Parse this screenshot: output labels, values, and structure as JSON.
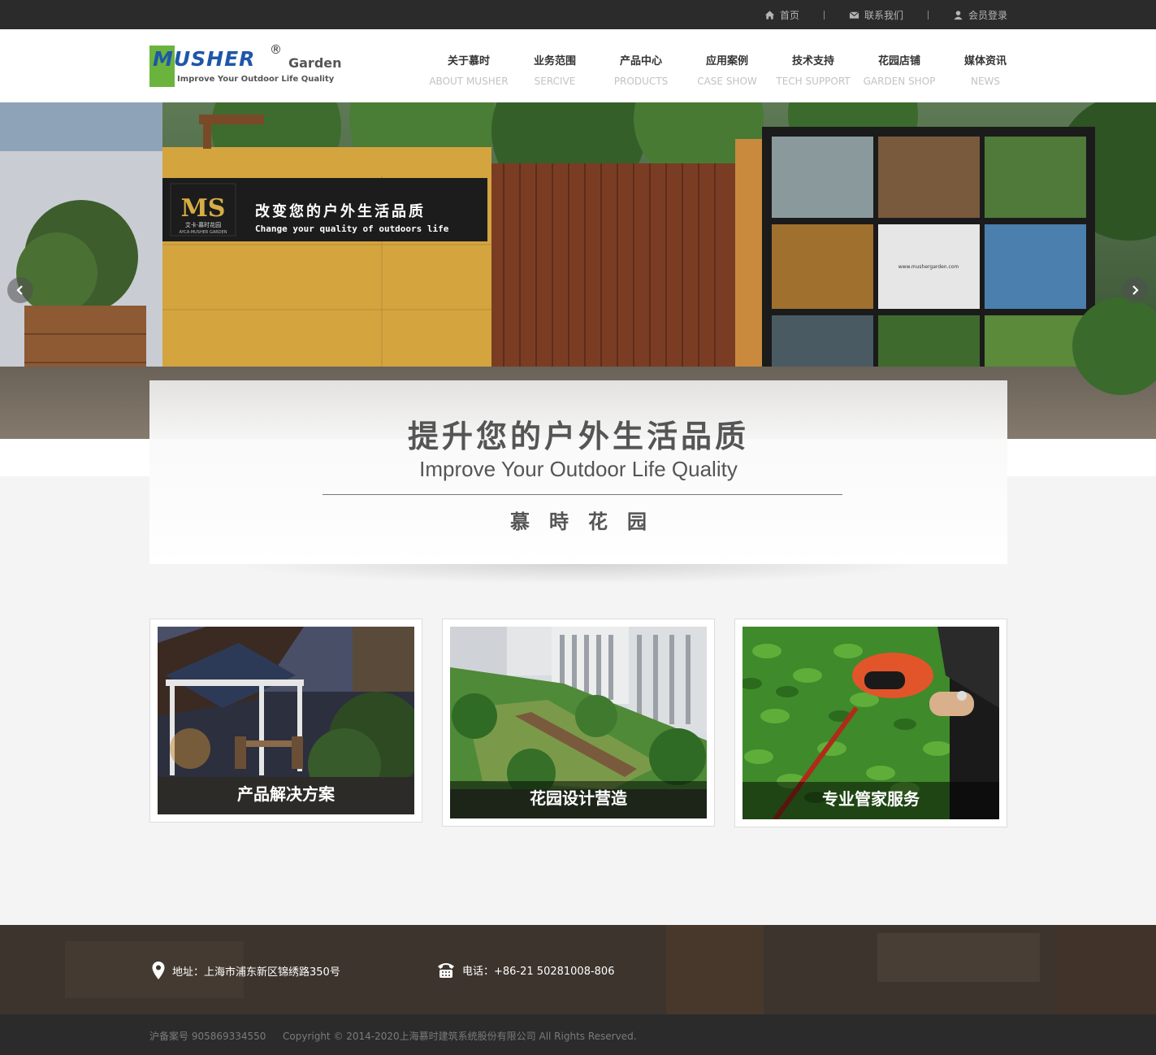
{
  "topbar": {
    "home": "首页",
    "contact": "联系我们",
    "login": "会员登录"
  },
  "logo": {
    "brand": "MUSHER",
    "reg": "®",
    "garden": "Garden",
    "tagline": "Improve Your Outdoor Life Quality"
  },
  "nav": [
    {
      "cn": "关于慕时",
      "en": "ABOUT MUSHER"
    },
    {
      "cn": "业务范围",
      "en": "SERCIVE"
    },
    {
      "cn": "产品中心",
      "en": "PRODUCTS"
    },
    {
      "cn": "应用案例",
      "en": "CASE SHOW"
    },
    {
      "cn": "技术支持",
      "en": "TECH SUPPORT"
    },
    {
      "cn": "花园店铺",
      "en": "GARDEN SHOP"
    },
    {
      "cn": "媒体资讯",
      "en": "NEWS"
    }
  ],
  "banner": {
    "sign_title": "改变您的户外生活品质",
    "sign_sub": "Change your quality of outdoors life",
    "sign_logo": "MS",
    "sign_logo_sub": "艾卡·慕时花园",
    "sign_logo_en": "AYCA·MUSHER GARDEN",
    "board_url": "www.mushergarden.com"
  },
  "overlay": {
    "title": "提升您的户外生活品质",
    "subtitle": "Improve Your Outdoor Life Quality",
    "brand": "慕時花园"
  },
  "cards": [
    {
      "caption": "产品解决方案"
    },
    {
      "caption": "花园设计营造"
    },
    {
      "caption": "专业管家服务"
    }
  ],
  "footer": {
    "address": "地址：上海市浦东新区锦绣路350号",
    "phone": "电话：+86-21 50281008-806",
    "icp": "沪备案号 905869334550",
    "copyright": "Copyright © 2014-2020上海慕时建筑系统股份有限公司 All Rights Reserved."
  },
  "colors": {
    "logo_green": "#6ab43e",
    "logo_blue": "#1f57a8",
    "topbar": "#2b2b2b"
  },
  "icons": [
    "home-icon",
    "mail-icon",
    "user-icon",
    "arrow-left-icon",
    "arrow-right-icon",
    "location-pin-icon",
    "telephone-icon"
  ]
}
